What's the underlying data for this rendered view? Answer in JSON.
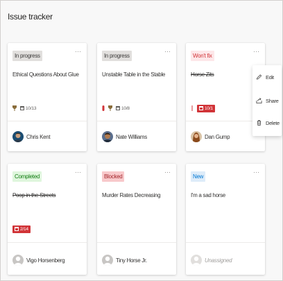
{
  "app": {
    "title": "Issue tracker"
  },
  "colors": {
    "in_progress_bg": "#e1dfdd",
    "in_progress_fg": "#3b3a39",
    "wont_fix_bg": "#fde7e9",
    "wont_fix_fg": "#d13438",
    "completed_bg": "#dff6dd",
    "completed_fg": "#107c10",
    "blocked_bg": "#f8c9cb",
    "blocked_fg": "#a4262c",
    "new_bg": "#deecf9",
    "new_fg": "#0078d4",
    "overdue": "#d13438"
  },
  "cards": [
    {
      "status": "In progress",
      "title": "Ethical Questions About Glue",
      "date": "10/13",
      "assignee": "Chris Kent",
      "more": "···"
    },
    {
      "status": "In progress",
      "title": "Unstable Table in the Stable",
      "date": "10/8",
      "assignee": "Nate Williams",
      "more": "···"
    },
    {
      "status": "Won't fix",
      "title": "Horse Zits",
      "date": "10/1",
      "assignee": "Dan Gump",
      "more": "···"
    },
    {
      "status": "Completed",
      "title": "Poop in the Streets",
      "date": "2/14",
      "assignee": "Vigo Horsenberg",
      "more": "···"
    },
    {
      "status": "Blocked",
      "title": "Murder Rates Decreasing",
      "assignee": "Tiny Horse Jr.",
      "more": "···"
    },
    {
      "status": "New",
      "title": "I'm a sad horse",
      "assignee": "Unassigned",
      "more": "···"
    }
  ],
  "menu": {
    "items": [
      "Edit",
      "Share",
      "Delete"
    ]
  }
}
